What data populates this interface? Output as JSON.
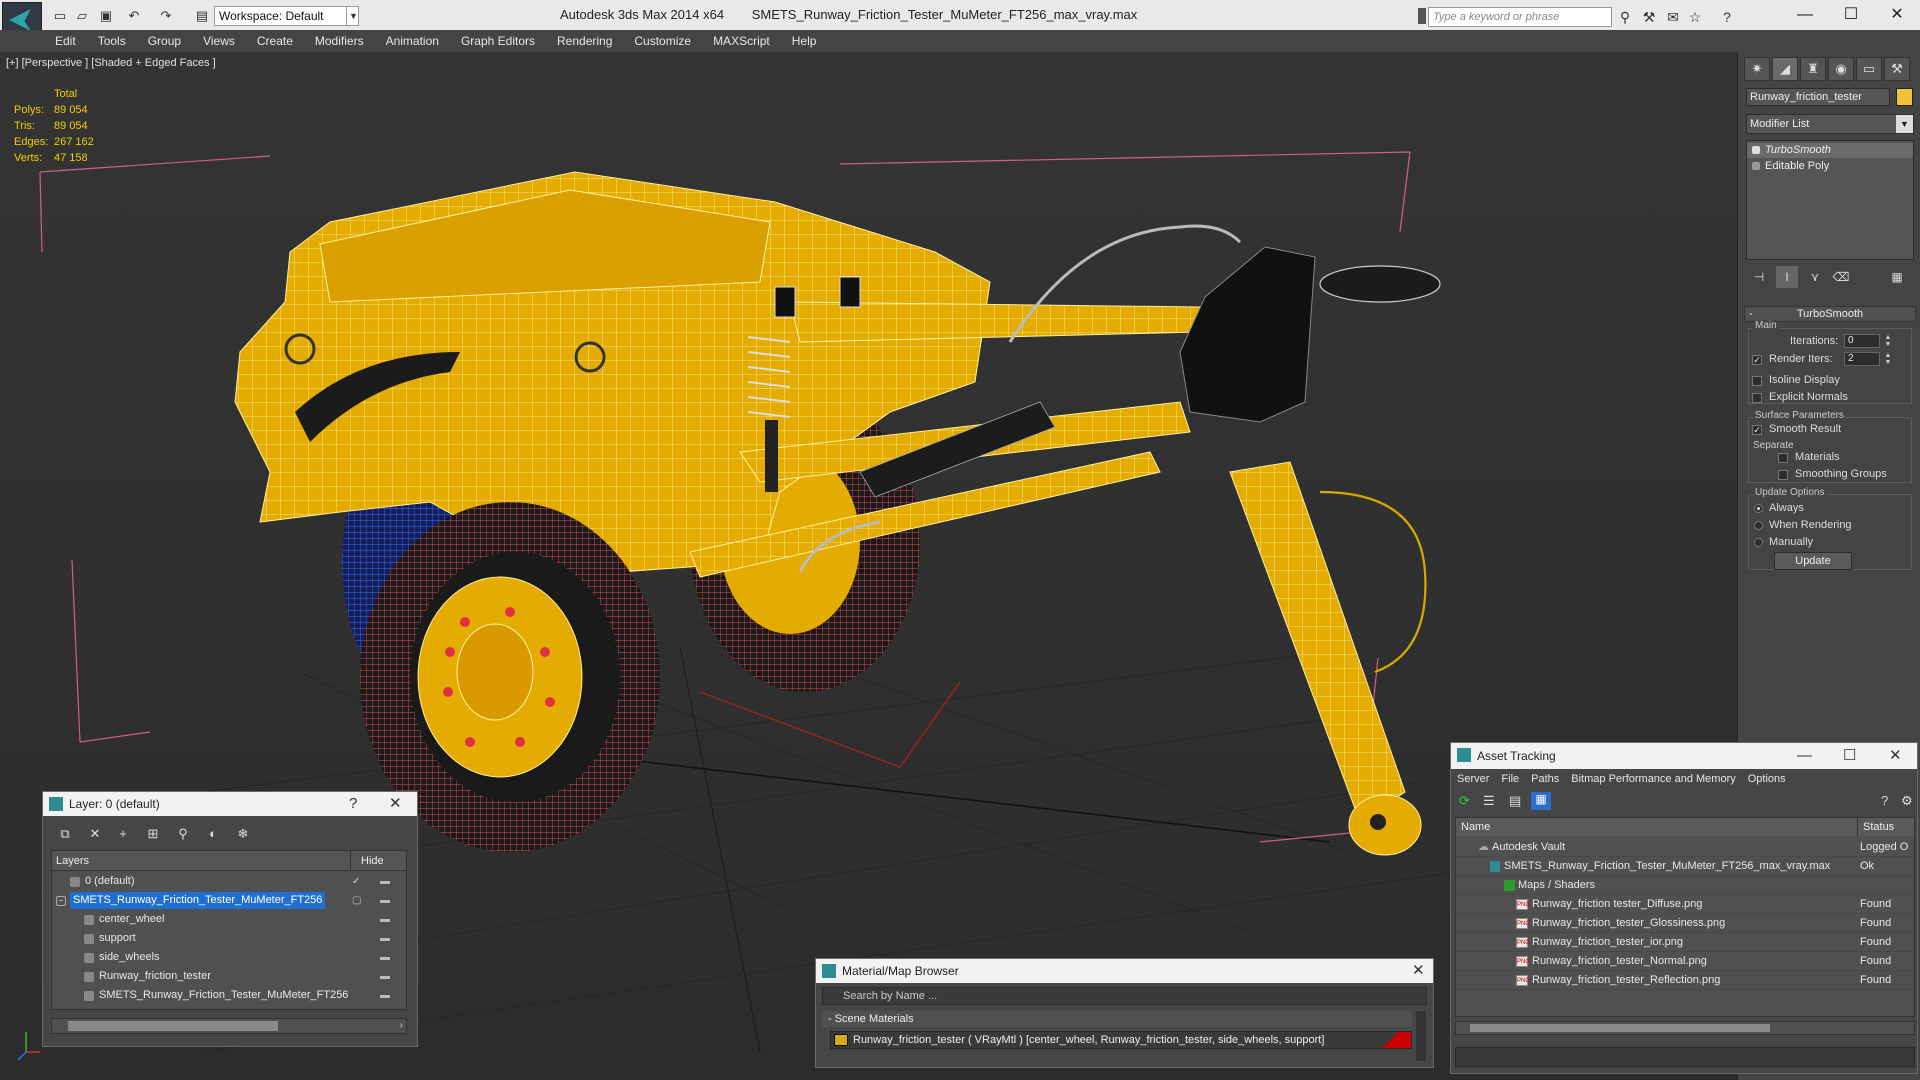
{
  "titlebar": {
    "app_name": "Autodesk 3ds Max  2014 x64",
    "file_name": "SMETS_Runway_Friction_Tester_MuMeter_FT256_max_vray.max",
    "workspace": "Workspace: Default",
    "search_placeholder": "Type a keyword or phrase"
  },
  "menu": [
    "Edit",
    "Tools",
    "Group",
    "Views",
    "Create",
    "Modifiers",
    "Animation",
    "Graph Editors",
    "Rendering",
    "Customize",
    "MAXScript",
    "Help"
  ],
  "viewport": {
    "label": "[+] [Perspective ] [Shaded + Edged Faces ]",
    "stats": {
      "header": "Total",
      "rows": [
        {
          "label": "Polys:",
          "value": "89 054"
        },
        {
          "label": "Tris:",
          "value": "89 054"
        },
        {
          "label": "Edges:",
          "value": "267 162"
        },
        {
          "label": "Verts:",
          "value": "47 158"
        }
      ]
    }
  },
  "command_panel": {
    "object_name": "Runway_friction_tester",
    "object_color": "#f0c33a",
    "modifier_list": "Modifier List",
    "stack": [
      "TurboSmooth",
      "Editable Poly"
    ],
    "rollout_title": "TurboSmooth",
    "main_label": "Main",
    "iterations_label": "Iterations:",
    "iterations_value": "0",
    "render_iters_label": "Render Iters:",
    "render_iters_value": "2",
    "isoline_label": "Isoline Display",
    "explicit_normals_label": "Explicit Normals",
    "surface_params_label": "Surface Parameters",
    "smooth_result_label": "Smooth Result",
    "separate_label": "Separate",
    "materials_label": "Materials",
    "smoothing_groups_label": "Smoothing Groups",
    "update_options_label": "Update Options",
    "always_label": "Always",
    "when_rendering_label": "When Rendering",
    "manually_label": "Manually",
    "update_button": "Update"
  },
  "layer_dialog": {
    "title": "Layer: 0 (default)",
    "col_layers": "Layers",
    "col_hide": "Hide",
    "rows": [
      {
        "name": "0 (default)",
        "indent": 0
      },
      {
        "name": "SMETS_Runway_Friction_Tester_MuMeter_FT256",
        "indent": 0,
        "selected": true
      },
      {
        "name": "center_wheel",
        "indent": 1
      },
      {
        "name": "support",
        "indent": 1
      },
      {
        "name": "side_wheels",
        "indent": 1
      },
      {
        "name": "Runway_friction_tester",
        "indent": 1
      },
      {
        "name": "SMETS_Runway_Friction_Tester_MuMeter_FT256",
        "indent": 1
      }
    ]
  },
  "material_browser": {
    "title": "Material/Map Browser",
    "search_placeholder": "Search by Name ...",
    "section": "- Scene Materials",
    "item": "Runway_friction_tester  ( VRayMtl )  [center_wheel, Runway_friction_tester, side_wheels, support]"
  },
  "asset_tracking": {
    "title": "Asset Tracking",
    "menu": [
      "Server",
      "File",
      "Paths",
      "Bitmap Performance and Memory",
      "Options"
    ],
    "col_name": "Name",
    "col_status": "Status",
    "rows": [
      {
        "name": "Autodesk Vault",
        "status": "Logged O",
        "indent": 1,
        "icon": "vault"
      },
      {
        "name": "SMETS_Runway_Friction_Tester_MuMeter_FT256_max_vray.max",
        "status": "Ok",
        "indent": 2,
        "icon": "max"
      },
      {
        "name": "Maps / Shaders",
        "status": "",
        "indent": 3,
        "icon": "folder"
      },
      {
        "name": "Runway_friction tester_Diffuse.png",
        "status": "Found",
        "indent": 4,
        "icon": "png"
      },
      {
        "name": "Runway_friction_tester_Glossiness.png",
        "status": "Found",
        "indent": 4,
        "icon": "png"
      },
      {
        "name": "Runway_friction_tester_ior.png",
        "status": "Found",
        "indent": 4,
        "icon": "png"
      },
      {
        "name": "Runway_friction_tester_Normal.png",
        "status": "Found",
        "indent": 4,
        "icon": "png"
      },
      {
        "name": "Runway_friction_tester_Reflection.png",
        "status": "Found",
        "indent": 4,
        "icon": "png"
      }
    ]
  },
  "colors": {
    "model_yellow": "#e8b000",
    "wire_red": "#e04050",
    "wire_blue": "#2a5bd8",
    "stats_yellow": "#f0d000",
    "selection_blue": "#1f6fd1"
  }
}
